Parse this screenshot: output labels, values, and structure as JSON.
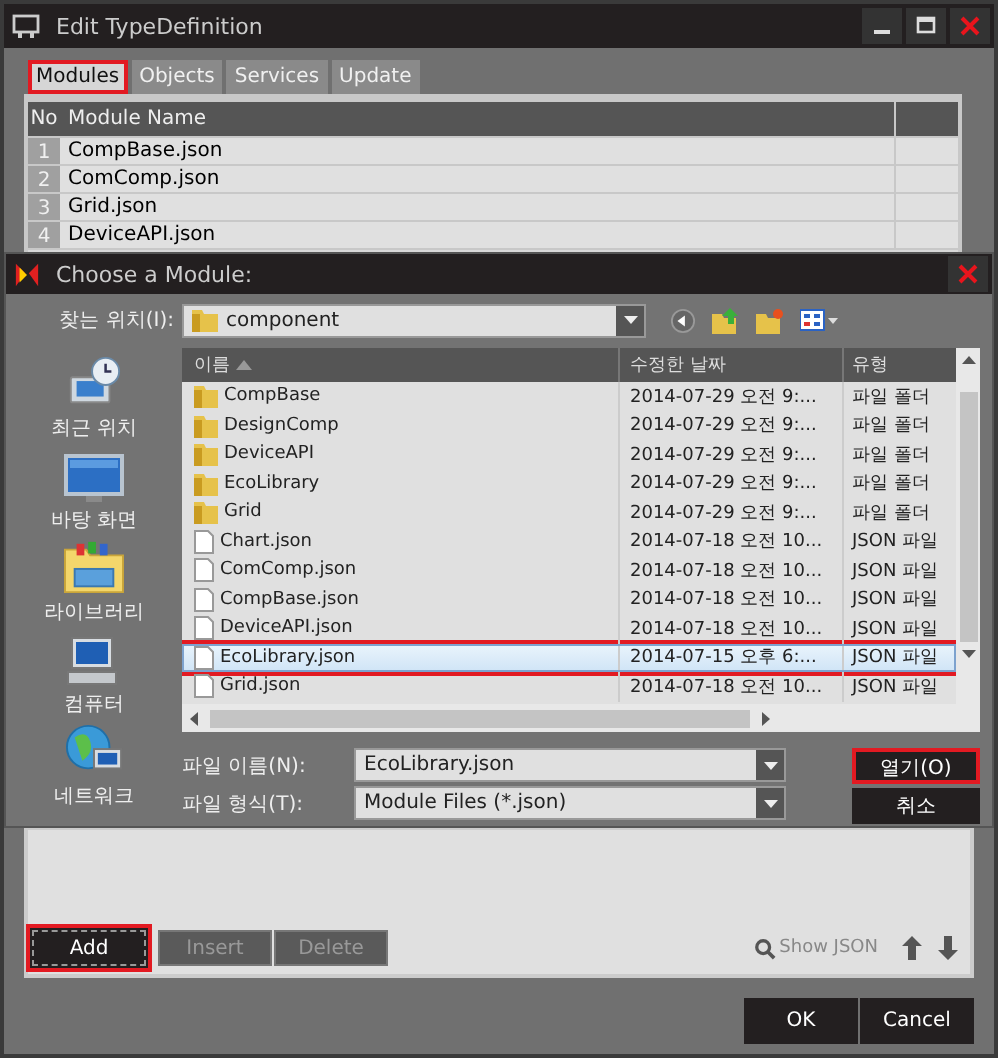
{
  "window": {
    "title": "Edit TypeDefinition"
  },
  "tabs": [
    {
      "label": "Modules",
      "selected": true,
      "highlighted": true
    },
    {
      "label": "Objects",
      "selected": false,
      "highlighted": false
    },
    {
      "label": "Services",
      "selected": false,
      "highlighted": false
    },
    {
      "label": "Update",
      "selected": false,
      "highlighted": false
    }
  ],
  "module_table": {
    "columns": [
      "No",
      "Module Name"
    ],
    "rows": [
      {
        "no": "1",
        "name": "CompBase.json"
      },
      {
        "no": "2",
        "name": "ComComp.json"
      },
      {
        "no": "3",
        "name": "Grid.json"
      },
      {
        "no": "4",
        "name": "DeviceAPI.json"
      }
    ]
  },
  "dialog": {
    "title": "Choose a Module:",
    "look_in_label": "찾는 위치(I):",
    "look_in_value": "component",
    "places": [
      {
        "label": "최근 위치",
        "kind": "recent"
      },
      {
        "label": "바탕 화면",
        "kind": "desktop"
      },
      {
        "label": "라이브러리",
        "kind": "library"
      },
      {
        "label": "컴퓨터",
        "kind": "computer"
      },
      {
        "label": "네트워크",
        "kind": "network"
      }
    ],
    "columns": [
      "이름",
      "수정한 날짜",
      "유형"
    ],
    "files": [
      {
        "name": "CompBase",
        "date": "2014-07-29 오전 9:...",
        "type": "파일 폴더",
        "kind": "folder",
        "selected": false
      },
      {
        "name": "DesignComp",
        "date": "2014-07-29 오전 9:...",
        "type": "파일 폴더",
        "kind": "folder",
        "selected": false
      },
      {
        "name": "DeviceAPI",
        "date": "2014-07-29 오전 9:...",
        "type": "파일 폴더",
        "kind": "folder",
        "selected": false
      },
      {
        "name": "EcoLibrary",
        "date": "2014-07-29 오전 9:...",
        "type": "파일 폴더",
        "kind": "folder",
        "selected": false
      },
      {
        "name": "Grid",
        "date": "2014-07-29 오전 9:...",
        "type": "파일 폴더",
        "kind": "folder",
        "selected": false
      },
      {
        "name": "Chart.json",
        "date": "2014-07-18 오전 10...",
        "type": "JSON 파일",
        "kind": "file",
        "selected": false
      },
      {
        "name": "ComComp.json",
        "date": "2014-07-18 오전 10...",
        "type": "JSON 파일",
        "kind": "file",
        "selected": false
      },
      {
        "name": "CompBase.json",
        "date": "2014-07-18 오전 10...",
        "type": "JSON 파일",
        "kind": "file",
        "selected": false
      },
      {
        "name": "DeviceAPI.json",
        "date": "2014-07-18 오전 10...",
        "type": "JSON 파일",
        "kind": "file",
        "selected": false
      },
      {
        "name": "EcoLibrary.json",
        "date": "2014-07-15 오후 6:...",
        "type": "JSON 파일",
        "kind": "file",
        "selected": true
      },
      {
        "name": "Grid.json",
        "date": "2014-07-18 오전 10...",
        "type": "JSON 파일",
        "kind": "file",
        "selected": false
      }
    ],
    "file_name_label": "파일 이름(N):",
    "file_name_value": "EcoLibrary.json",
    "file_type_label": "파일 형식(T):",
    "file_type_value": "Module Files (*.json)",
    "open_button": {
      "label": "열기(O)",
      "highlighted": true
    },
    "cancel_button": "취소"
  },
  "toolbar": {
    "buttons": [
      {
        "label": "Add",
        "disabled": false,
        "highlighted": true
      },
      {
        "label": "Insert",
        "disabled": true,
        "highlighted": false
      },
      {
        "label": "Delete",
        "disabled": true,
        "highlighted": false
      }
    ],
    "show_json": "Show JSON"
  },
  "footer": {
    "ok": "OK",
    "cancel": "Cancel"
  }
}
